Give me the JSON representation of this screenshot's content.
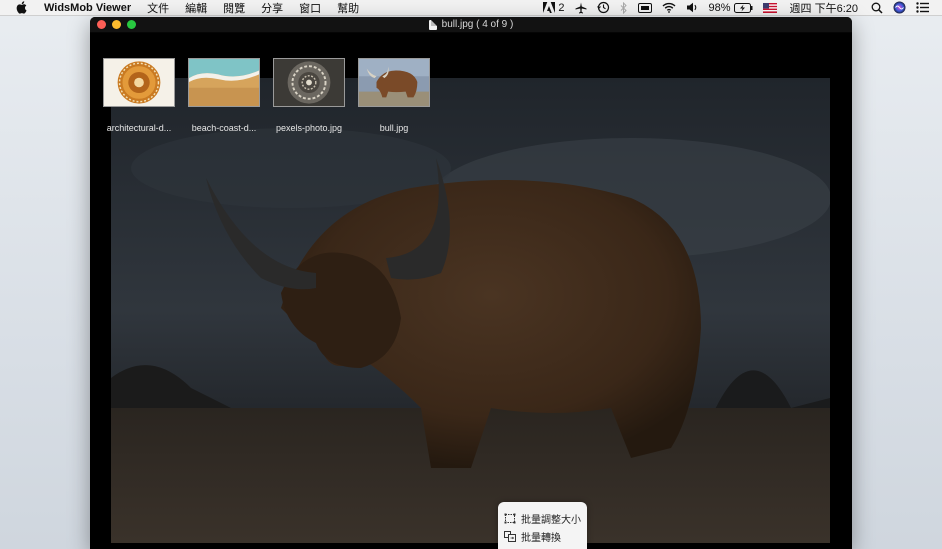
{
  "menubar": {
    "app_name": "WidsMob Viewer",
    "items": [
      "文件",
      "編輯",
      "閱覽",
      "分享",
      "窗口",
      "幫助"
    ],
    "status": {
      "adobe_count": "2",
      "battery": "98%",
      "clock": "週四 下午6:20"
    }
  },
  "window": {
    "title": "bull.jpg ( 4 of 9 )"
  },
  "thumbnails": [
    {
      "label": "architectural-d..."
    },
    {
      "label": "beach-coast-d..."
    },
    {
      "label": "pexels-photo.jpg"
    },
    {
      "label": "bull.jpg"
    }
  ],
  "popup": {
    "batch_resize": "批量調整大小",
    "batch_convert": "批量轉換"
  },
  "colors": {
    "close": "#fd5f57",
    "minimize": "#febc2e",
    "maximize": "#28c840"
  }
}
